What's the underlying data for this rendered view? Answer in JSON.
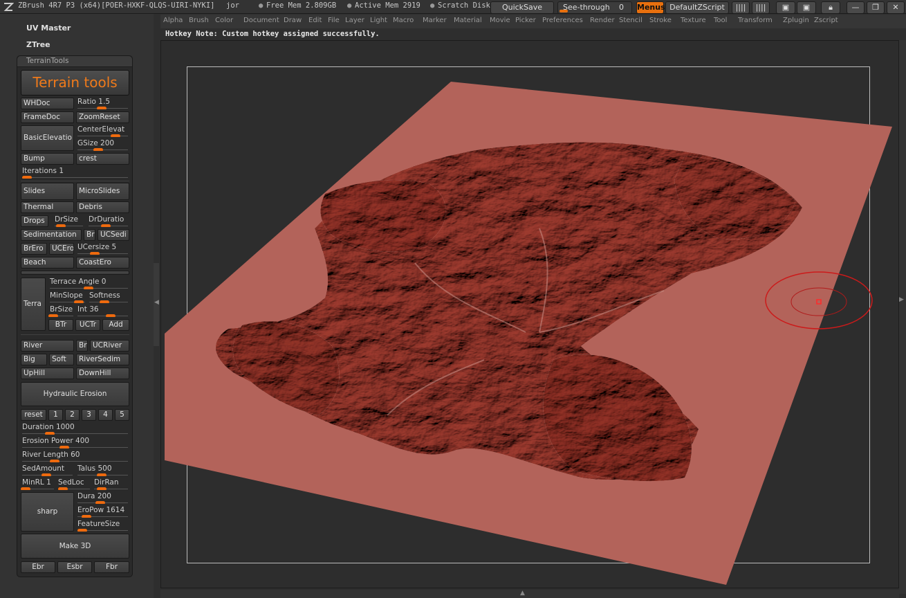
{
  "titlebar": {
    "app_title": "ZBrush 4R7 P3 (x64)[POER-HXKF-QLQS-UIRI-NYKI]",
    "user": "jor",
    "free_mem": "Free Mem 2.809GB",
    "active_mem": "Active Mem 2919",
    "scratch": "Scratch Disk",
    "quicksave": "QuickSave",
    "see_through_label": "See-through",
    "see_through_value": "0",
    "menus": "Menus",
    "default_zscript": "DefaultZScript"
  },
  "menubar": {
    "items": [
      "Alpha",
      "Brush",
      "Color",
      "Document",
      "Draw",
      "Edit",
      "File",
      "Layer",
      "Light",
      "Macro",
      "Marker",
      "Material",
      "Movie",
      "Picker",
      "Preferences",
      "Render",
      "Stencil",
      "Stroke",
      "Texture",
      "Tool",
      "Transform",
      "Zplugin",
      "Zscript"
    ]
  },
  "hotkey_note": "Hotkey Note: Custom hotkey assigned successfully.",
  "left": {
    "uv_master": "UV Master",
    "ztree": "ZTree"
  },
  "palette": {
    "title": "TerrainTools",
    "big_title": "Terrain tools",
    "whdoc": "WHDoc",
    "ratio": "Ratio 1.5",
    "framedoc": "FrameDoc",
    "zoomreset": "ZoomReset",
    "basicelevation": "BasicElevatio",
    "centerelevat": "CenterElevat",
    "gsize": "GSize 200",
    "bump": "Bump",
    "crest": "crest",
    "iterations": "Iterations 1",
    "slides": "Slides",
    "microslides": "MicroSlides",
    "thermal": "Thermal",
    "debris": "Debris",
    "drops": "Drops",
    "drsize": "DrSize",
    "drduration": "DrDuratio",
    "sedimentation": "Sedimentation",
    "br1": "Br",
    "ucsedi": "UCSedi",
    "brero": "BrEro",
    "ucero": "UCEro",
    "ucersize": "UCersize 5",
    "beach": "Beach",
    "coastero": "CoastEro",
    "terra": "Terra",
    "terrace_angle": "Terrace Angle 0",
    "minslope": "MinSlope",
    "softness": "Softness",
    "brsize": "BrSize",
    "int": "Int 36",
    "btr": "BTr",
    "uctr": "UCTr",
    "add": "Add",
    "river": "River",
    "br2": "Br",
    "ucriver": "UCRiver",
    "big": "Big",
    "soft": "Soft",
    "riversedim": "RiverSedim",
    "uphill": "UpHill",
    "downhill": "DownHill",
    "hydraulic": "Hydraulic Erosion",
    "reset": "reset",
    "n1": "1",
    "n2": "2",
    "n3": "3",
    "n4": "4",
    "n5": "5",
    "duration": "Duration 1000",
    "erosion_power": "Erosion Power 400",
    "river_length": "River Length 60",
    "sedamount": "SedAmount",
    "talus": "Talus 500",
    "minrl": "MinRL 1",
    "sedloc": "SedLoc",
    "dirran": "DirRan",
    "sharp": "sharp",
    "dura": "Dura 200",
    "eropow": "EroPow 1614",
    "featuresize": "FeatureSize",
    "make3d": "Make 3D",
    "ebr": "Ebr",
    "esbr": "Esbr",
    "fbr": "Fbr"
  },
  "colors": {
    "accent": "#e8700e",
    "terrain": "#b56358",
    "brush_ring": "#cc1a1a"
  },
  "icons": [
    "zbrush-logo-icon",
    "close-icon",
    "minimize-icon",
    "maximize-icon",
    "lock-icon"
  ]
}
